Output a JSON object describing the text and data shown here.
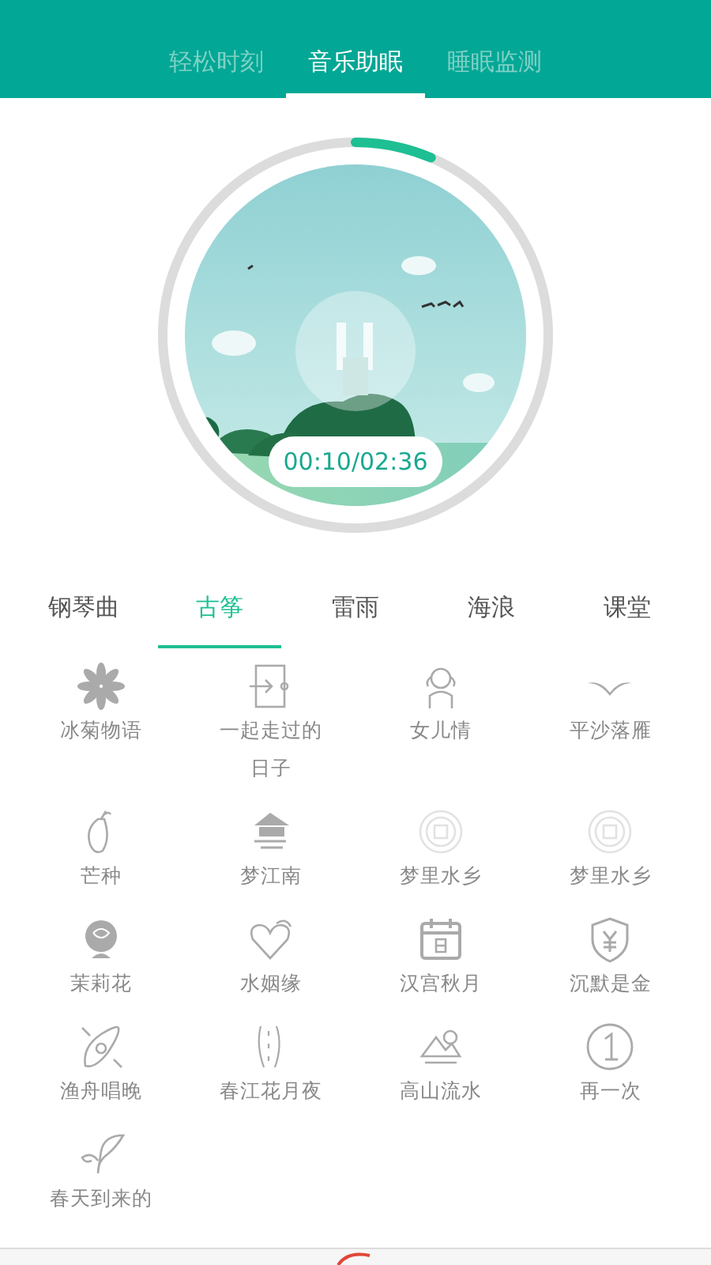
{
  "header_tabs": [
    {
      "label": "轻松时刻",
      "selected": false
    },
    {
      "label": "音乐助眠",
      "selected": true
    },
    {
      "label": "睡眠监测",
      "selected": false
    }
  ],
  "player": {
    "time": "00:10/02:36"
  },
  "categories": [
    {
      "label": "钢琴曲",
      "selected": false
    },
    {
      "label": "古筝",
      "selected": true
    },
    {
      "label": "雷雨",
      "selected": false
    },
    {
      "label": "海浪",
      "selected": false
    },
    {
      "label": "课堂",
      "selected": false
    }
  ],
  "tracks": [
    {
      "lines": [
        "冰菊物语"
      ]
    },
    {
      "lines": [
        "一起走过的",
        "日子"
      ]
    },
    {
      "lines": [
        "女儿情"
      ]
    },
    {
      "lines": [
        "平沙落雁"
      ]
    },
    {
      "lines": [
        "芒种"
      ]
    },
    {
      "lines": [
        "梦江南"
      ]
    },
    {
      "lines": [
        "梦里水乡"
      ]
    },
    {
      "lines": [
        "梦里水乡"
      ]
    },
    {
      "lines": [
        "茉莉花"
      ]
    },
    {
      "lines": [
        "水姻缘"
      ]
    },
    {
      "lines": [
        "汉宫秋月"
      ]
    },
    {
      "lines": [
        "沉默是金"
      ]
    },
    {
      "lines": [
        "渔舟唱晚"
      ]
    },
    {
      "lines": [
        "春江花月夜"
      ]
    },
    {
      "lines": [
        "高山流水"
      ]
    },
    {
      "lines": [
        "再一次"
      ]
    },
    {
      "lines": [
        "春天到来的"
      ]
    }
  ]
}
